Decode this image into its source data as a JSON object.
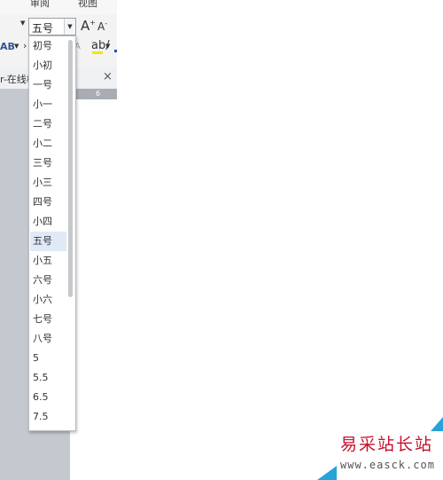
{
  "ribbon": {
    "tabs": [
      "审阅",
      "视图"
    ],
    "font_size_value": "五号",
    "grow_font_glyph": "A",
    "shrink_font_glyph": "A",
    "grow_sup": "+",
    "shrink_sup": "-",
    "strikethrough_label": "AB",
    "highlight_glyph": "ab",
    "dim_glyph": "A"
  },
  "document_tab": {
    "label": "r-在线校",
    "close_glyph": "×"
  },
  "ruler": {
    "number": "6"
  },
  "font_size_dropdown": {
    "selected": "五号",
    "options": [
      "初号",
      "小初",
      "一号",
      "小一",
      "二号",
      "小二",
      "三号",
      "小三",
      "四号",
      "小四",
      "五号",
      "小五",
      "六号",
      "小六",
      "七号",
      "八号",
      "5",
      "5.5",
      "6.5",
      "7.5"
    ]
  },
  "watermark": {
    "title": "易采站长站",
    "url": "www.easck.com"
  },
  "colors": {
    "selected_bg": "#dfe9f7",
    "workspace": "#c4c8cf",
    "watermark_red": "#c8102e",
    "watermark_blue": "#27a3d8"
  }
}
